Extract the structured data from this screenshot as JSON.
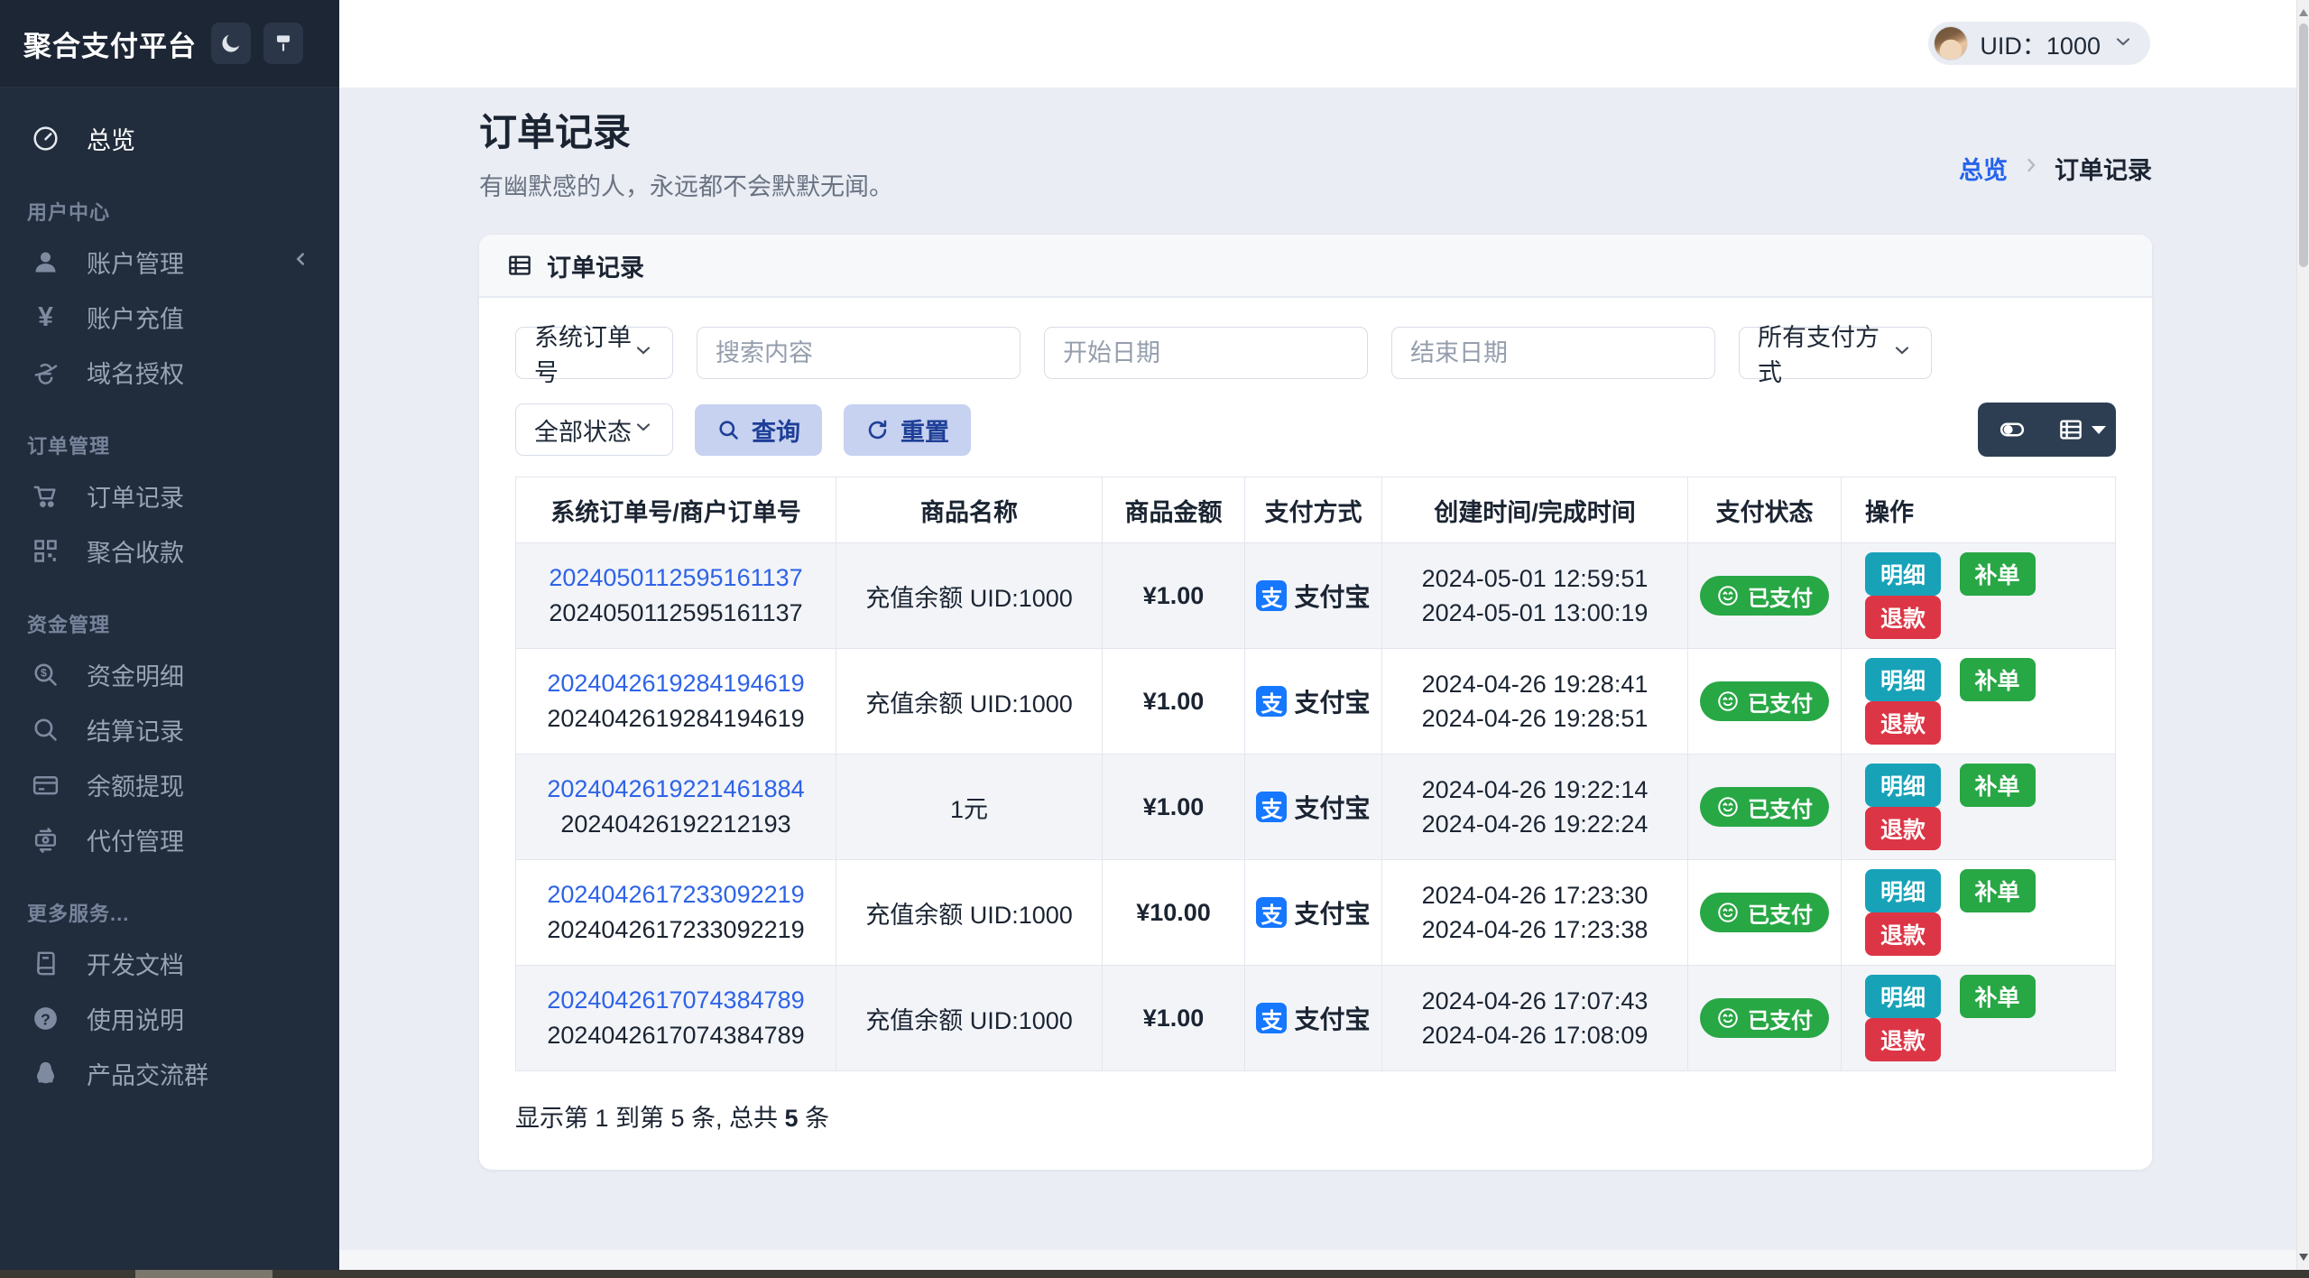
{
  "colors": {
    "sidebar_bg": "#212c3c",
    "content_bg": "#eaedf3",
    "primary_blue": "#2563eb",
    "link_blue": "#2e63e7",
    "alipay_blue": "#1677ff",
    "success_green": "#28a745",
    "info_teal": "#17a2b8",
    "danger_red": "#dc3545",
    "soft_button_bg": "#c7d1f0",
    "soft_button_text": "#1e3f97",
    "toolbar_dark": "#2d3e52"
  },
  "sidebar": {
    "logo": "聚合支付平台",
    "sections": [
      {
        "label": "",
        "items": [
          {
            "icon": "gauge-icon",
            "label": "总览"
          }
        ]
      },
      {
        "label": "用户中心",
        "items": [
          {
            "icon": "user-icon",
            "label": "账户管理"
          },
          {
            "icon": "yen-icon",
            "label": "账户充值"
          },
          {
            "icon": "ie-globe-icon",
            "label": "域名授权"
          }
        ]
      },
      {
        "label": "订单管理",
        "items": [
          {
            "icon": "cart-icon",
            "label": "订单记录"
          },
          {
            "icon": "qrcode-icon",
            "label": "聚合收款"
          }
        ]
      },
      {
        "label": "资金管理",
        "items": [
          {
            "icon": "search-dollar-icon",
            "label": "资金明细"
          },
          {
            "icon": "search-icon",
            "label": "结算记录"
          },
          {
            "icon": "credit-card-icon",
            "label": "余额提现"
          },
          {
            "icon": "money-transfer-icon",
            "label": "代付管理"
          }
        ]
      },
      {
        "label": "更多服务...",
        "items": [
          {
            "icon": "book-icon",
            "label": "开发文档"
          },
          {
            "icon": "question-icon",
            "label": "使用说明"
          },
          {
            "icon": "qq-icon",
            "label": "产品交流群"
          }
        ]
      }
    ]
  },
  "header": {
    "uid": "UID：1000"
  },
  "page": {
    "title": "订单记录",
    "subtitle": "有幽默感的人，永远都不会默默无闻。",
    "breadcrumb_home": "总览",
    "breadcrumb_current": "订单记录"
  },
  "card": {
    "title": "订单记录"
  },
  "filters": {
    "order_type_value": "系统订单号",
    "search_placeholder": "搜索内容",
    "start_date_placeholder": "开始日期",
    "end_date_placeholder": "结束日期",
    "pay_method_value": "所有支付方式",
    "status_value": "全部状态",
    "query_label": "查询",
    "reset_label": "重置"
  },
  "table": {
    "columns": [
      "系统订单号/商户订单号",
      "商品名称",
      "商品金额",
      "支付方式",
      "创建时间/完成时间",
      "支付状态",
      "操作"
    ],
    "alipay_glyph": "支",
    "actions": {
      "detail": "明细",
      "reorder": "补单",
      "refund": "退款"
    },
    "rows": [
      {
        "sys_no": "2024050112595161137",
        "mch_no": "2024050112595161137",
        "product": "充值余额 UID:1000",
        "amount": "¥1.00",
        "pay": "支付宝",
        "created": "2024-05-01 12:59:51",
        "finished": "2024-05-01 13:00:19",
        "status": "已支付"
      },
      {
        "sys_no": "2024042619284194619",
        "mch_no": "2024042619284194619",
        "product": "充值余额 UID:1000",
        "amount": "¥1.00",
        "pay": "支付宝",
        "created": "2024-04-26 19:28:41",
        "finished": "2024-04-26 19:28:51",
        "status": "已支付"
      },
      {
        "sys_no": "2024042619221461884",
        "mch_no": "20240426192212193",
        "product": "1元",
        "amount": "¥1.00",
        "pay": "支付宝",
        "created": "2024-04-26 19:22:14",
        "finished": "2024-04-26 19:22:24",
        "status": "已支付"
      },
      {
        "sys_no": "2024042617233092219",
        "mch_no": "2024042617233092219",
        "product": "充值余额 UID:1000",
        "amount": "¥10.00",
        "pay": "支付宝",
        "created": "2024-04-26 17:23:30",
        "finished": "2024-04-26 17:23:38",
        "status": "已支付"
      },
      {
        "sys_no": "2024042617074384789",
        "mch_no": "2024042617074384789",
        "product": "充值余额 UID:1000",
        "amount": "¥1.00",
        "pay": "支付宝",
        "created": "2024-04-26 17:07:43",
        "finished": "2024-04-26 17:08:09",
        "status": "已支付"
      }
    ],
    "footer_prefix": "显示第 1 到第 5 条, 总共 ",
    "footer_count": "5",
    "footer_suffix": " 条"
  }
}
